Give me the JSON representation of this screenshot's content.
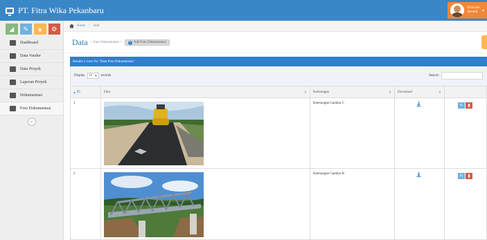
{
  "app": {
    "title": "PT. Fitra Wika Pekanbaru"
  },
  "user": {
    "greeting": "Welcome,",
    "name": "Jaenudi"
  },
  "shortcuts": [
    {
      "icon": "signal-icon",
      "color": "#87b87f",
      "glyph": "◢"
    },
    {
      "icon": "pencil-icon",
      "color": "#6fb3e0",
      "glyph": "✎"
    },
    {
      "icon": "warning-icon",
      "color": "#ffb752",
      "glyph": "▲"
    },
    {
      "icon": "cogs-icon",
      "color": "#d15b47",
      "glyph": "⚙"
    }
  ],
  "sidebar": {
    "items": [
      {
        "label": "Dashboard",
        "icon": "dashboard-icon"
      },
      {
        "label": "Data Vendor",
        "icon": "truck-icon"
      },
      {
        "label": "Data Proyek",
        "icon": "wrench-icon"
      },
      {
        "label": "Laporan Proyek",
        "icon": "book-icon"
      },
      {
        "label": "Dokumentasi",
        "icon": "file-icon"
      },
      {
        "label": "Foto Dokumentasi",
        "icon": "picture-icon"
      }
    ],
    "active_index": 5
  },
  "breadcrumbs": {
    "home": "Home",
    "separator": ">",
    "current": "Staff"
  },
  "page": {
    "title": "Data",
    "subtitle": "> Foto Dokumentasi >",
    "add_button": "Add Foto Dokumentasi"
  },
  "table": {
    "results_text": "Results 2 rows for \"Data Foto Dokumentasi\"",
    "display_label": "Display",
    "page_length": "10",
    "records_label": "records",
    "search_label": "Search:",
    "search_value": "",
    "columns": {
      "id": "ID",
      "foto": "Foto",
      "keterangan": "Keterangan",
      "download": "Download",
      "actions": ""
    },
    "rows": [
      {
        "id": "1",
        "keterangan": "Keterangan Gambar C",
        "photo": "road-paving-photo"
      },
      {
        "id": "2",
        "keterangan": "Keterangan Gambar B",
        "photo": "steel-bridge-photo"
      }
    ]
  },
  "colors": {
    "navbar": "#3a87c8",
    "user_badge": "#f0883a",
    "results_bar": "#307ecc",
    "edit": "#6fb3e0",
    "delete": "#d15b47"
  }
}
